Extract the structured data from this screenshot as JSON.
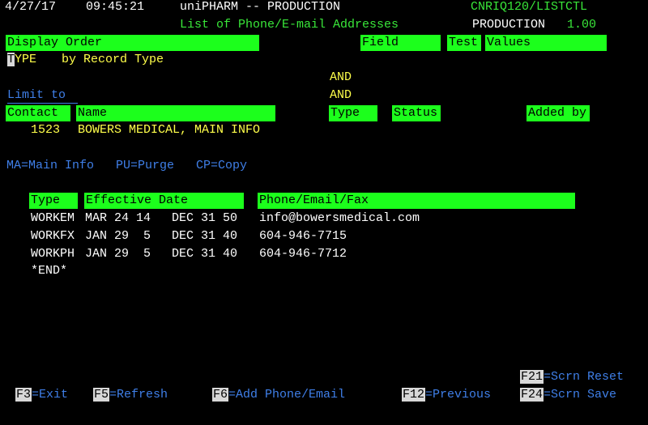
{
  "header": {
    "date": "4/27/17",
    "time": "09:45:21",
    "system": "uniPHARM -- PRODUCTION",
    "program": "CNRIQ120/LISTCTL",
    "screen_title": "List of Phone/E-mail Addresses",
    "env_label": "PRODUCTION",
    "version": "1.00"
  },
  "sort": {
    "display_order_label": "Display Order",
    "field_label": "Field",
    "test_label": "Test",
    "values_label": "Values",
    "order_code_first": "T",
    "order_code_rest": "YPE",
    "order_desc": "by Record Type"
  },
  "limit": {
    "label": "Limit to",
    "and1": "AND",
    "and2": "AND"
  },
  "columns": {
    "contact": "Contact",
    "name": "Name",
    "type": "Type",
    "status": "Status",
    "added_by": "Added by"
  },
  "contact": {
    "id": "1523",
    "name": "BOWERS MEDICAL, MAIN INFO"
  },
  "options": "MA=Main Info   PU=Purge   CP=Copy",
  "list": {
    "headers": {
      "type": "Type",
      "effective": "Effective Date",
      "contact_info": "Phone/Email/Fax"
    },
    "rows": [
      {
        "type": "WORKEM",
        "from": "MAR 24 14",
        "to": "DEC 31 50",
        "value": "info@bowersmedical.com"
      },
      {
        "type": "WORKFX",
        "from": "JAN 29  5",
        "to": "DEC 31 40",
        "value": "604-946-7715"
      },
      {
        "type": "WORKPH",
        "from": "JAN 29  5",
        "to": "DEC 31 40",
        "value": "604-946-7712"
      }
    ],
    "end_marker": "*END*"
  },
  "fkeys": {
    "f21": {
      "key": "F21",
      "label": "=Scrn Reset"
    },
    "f3": {
      "key": "F3",
      "label": "=Exit"
    },
    "f5": {
      "key": "F5",
      "label": "=Refresh"
    },
    "f6": {
      "key": "F6",
      "label": "=Add Phone/Email"
    },
    "f12": {
      "key": "F12",
      "label": "=Previous"
    },
    "f24": {
      "key": "F24",
      "label": "=Scrn Save"
    }
  },
  "colors": {
    "background": "#000000",
    "field_bar": "#1cff1c",
    "protected_text": "#ffffff",
    "input_text": "#ffff4a",
    "title_text": "#39e639",
    "label_text": "#3f7fe8"
  }
}
